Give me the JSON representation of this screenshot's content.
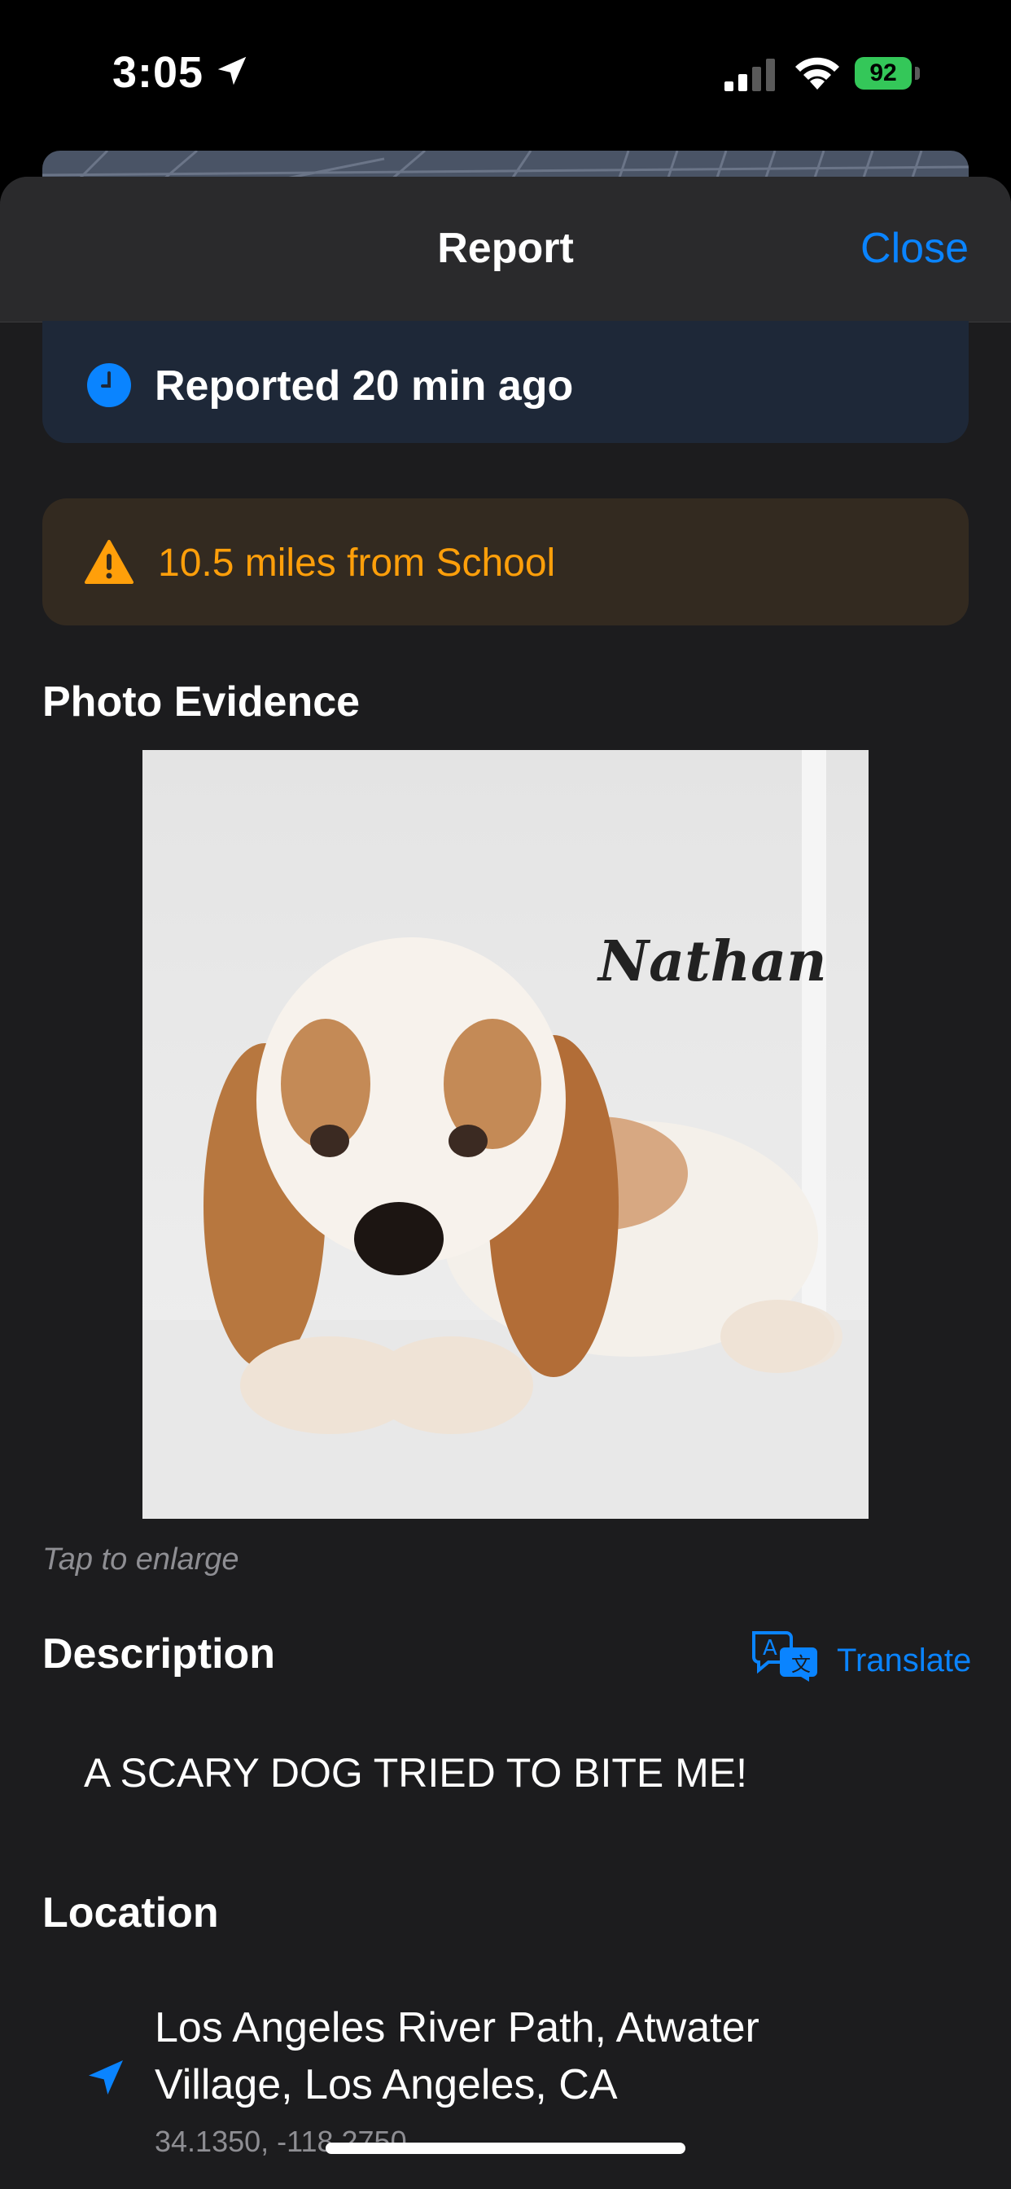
{
  "status_bar": {
    "time": "3:05",
    "battery": "92"
  },
  "header": {
    "title": "Report",
    "close_label": "Close"
  },
  "reported": {
    "text": "Reported 20 min ago"
  },
  "warning": {
    "text": "10.5 miles from School"
  },
  "photo_section": {
    "title": "Photo Evidence",
    "photo_label": "Nathan",
    "caption": "Tap to enlarge"
  },
  "description": {
    "title": "Description",
    "translate_label": "Translate",
    "text": "A SCARY DOG TRIED TO BITE ME!"
  },
  "location": {
    "title": "Location",
    "address": "Los Angeles River Path, Atwater Village, Los Angeles, CA",
    "coordinates": "34.1350, -118.2750"
  },
  "colors": {
    "accent": "#0a84ff",
    "warning": "#ff9f0a",
    "battery": "#34c759"
  }
}
